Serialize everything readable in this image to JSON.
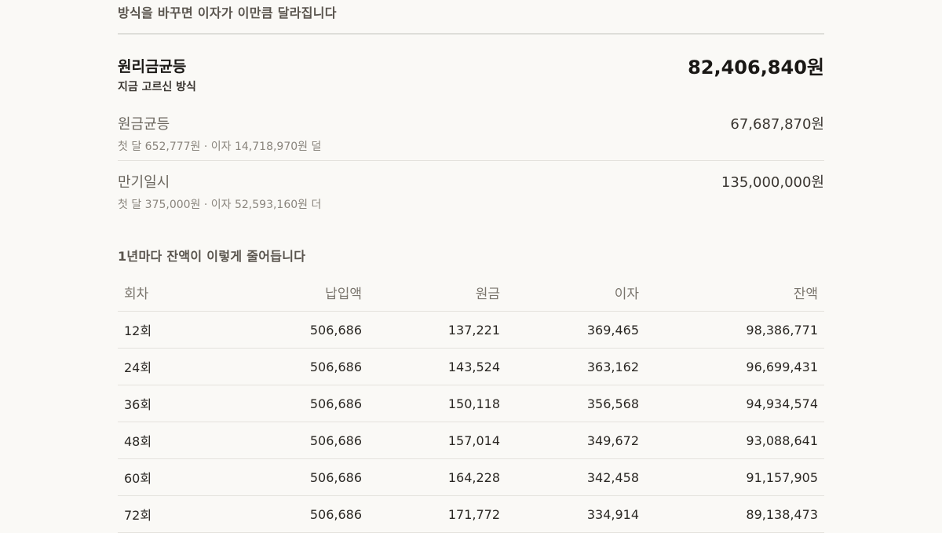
{
  "comparison": {
    "heading": "방식을 바꾸면 이자가 이만큼 달라집니다",
    "current": {
      "name": "원리금균등",
      "subtitle": "지금 고르신 방식",
      "total": "82,406,840원"
    },
    "alternatives": [
      {
        "name": "원금균등",
        "detail": "첫 달 652,777원 · 이자 14,718,970원 덜",
        "total": "67,687,870원"
      },
      {
        "name": "만기일시",
        "detail": "첫 달 375,000원 · 이자 52,593,160원 더",
        "total": "135,000,000원"
      }
    ]
  },
  "schedule": {
    "heading": "1년마다 잔액이 이렇게 줄어듭니다",
    "columns": [
      "회차",
      "납입액",
      "원금",
      "이자",
      "잔액"
    ],
    "rows": [
      [
        "12회",
        "506,686",
        "137,221",
        "369,465",
        "98,386,771"
      ],
      [
        "24회",
        "506,686",
        "143,524",
        "363,162",
        "96,699,431"
      ],
      [
        "36회",
        "506,686",
        "150,118",
        "356,568",
        "94,934,574"
      ],
      [
        "48회",
        "506,686",
        "157,014",
        "349,672",
        "93,088,641"
      ],
      [
        "60회",
        "506,686",
        "164,228",
        "342,458",
        "91,157,905"
      ],
      [
        "72회",
        "506,686",
        "171,772",
        "334,914",
        "89,138,473"
      ]
    ]
  }
}
